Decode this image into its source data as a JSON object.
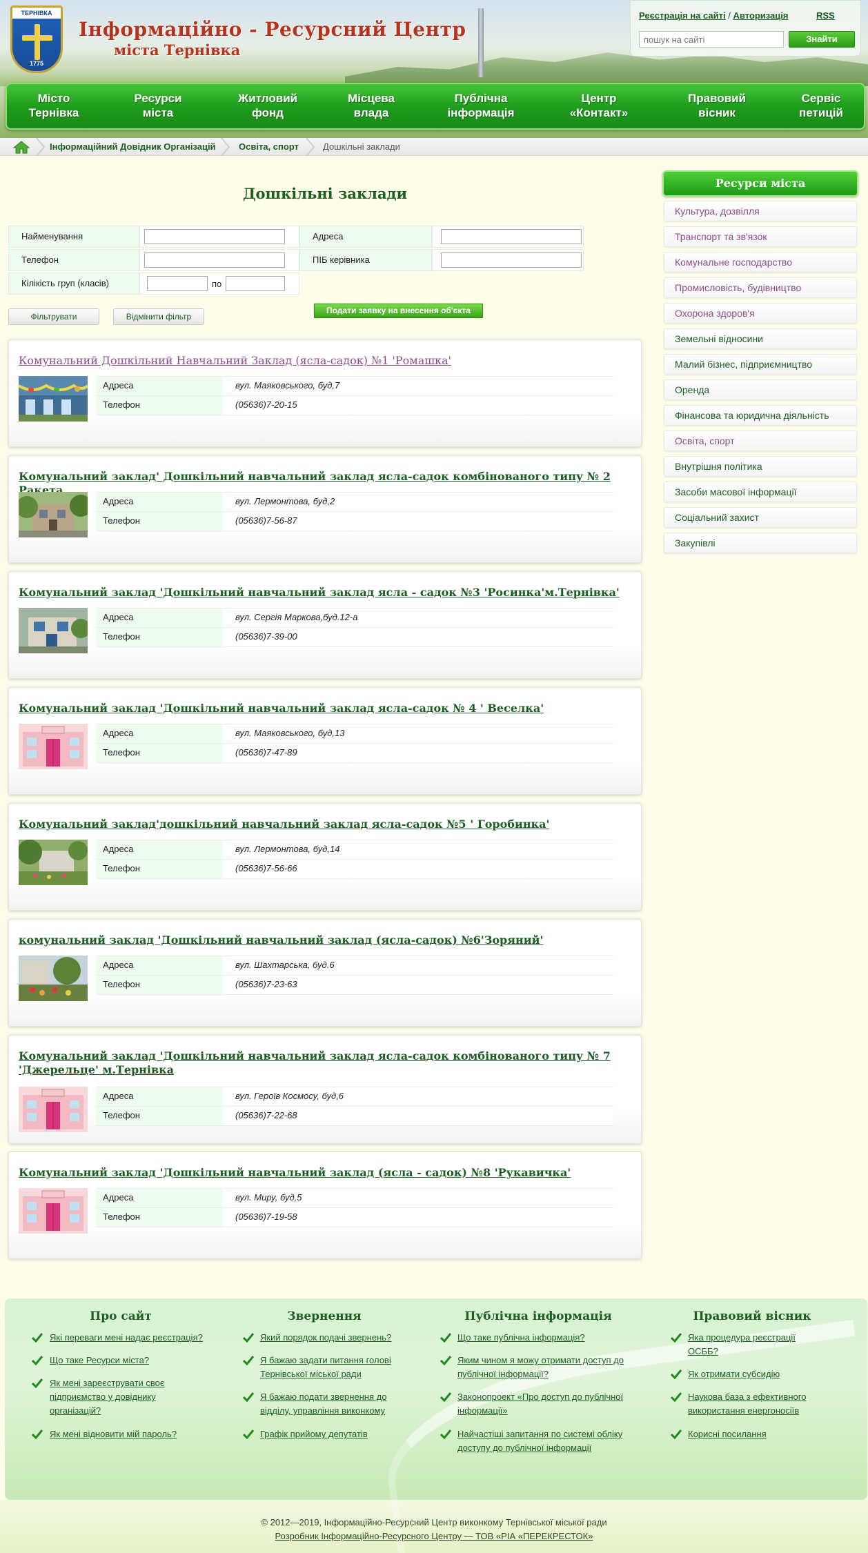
{
  "header": {
    "crest_top": "ТЕРНІВКА",
    "crest_year": "1775",
    "title": "Інформаційно - Ресурсний  Центр",
    "subtitle": "міста Тернівка",
    "register_link": "Реєстрація на сайті",
    "auth_separator": "/",
    "login_link": "Авторизація",
    "rss_link": "RSS",
    "search_placeholder": "пошук на сайті",
    "search_button": "Знайти"
  },
  "nav": [
    {
      "line1": "Місто",
      "line2": "Тернівка"
    },
    {
      "line1": "Ресурси",
      "line2": "міста"
    },
    {
      "line1": "Житловий",
      "line2": "фонд"
    },
    {
      "line1": "Місцева",
      "line2": "влада"
    },
    {
      "line1": "Публічна",
      "line2": "інформація"
    },
    {
      "line1": "Центр",
      "line2": "«Контакт»"
    },
    {
      "line1": "Правовий",
      "line2": "вісник"
    },
    {
      "line1": "Сервіс",
      "line2": "петицій"
    }
  ],
  "breadcrumb": {
    "item1": "Інформаційний Довідник Організацій",
    "item2": "Освіта, спорт",
    "current": "Дошкільні заклади"
  },
  "page_title": "Дошкільні заклади",
  "filter": {
    "name_label": "Найменування",
    "address_label": "Адреса",
    "phone_label": "Телефон",
    "head_label": "ПІБ керівника",
    "groups_label": "Кілікість груп (класів)",
    "to_label": "по",
    "filter_button": "Фільтрувати",
    "reset_button": "Відмінити фільтр",
    "submit_button": "Подати заявку на внесення об'єкта"
  },
  "labels": {
    "address": "Адреса",
    "phone": "Телефон"
  },
  "establishments": [
    {
      "title": "Комунальний Дошкільний Навчальний Заклад (ясла-садок) №1 'Ромашка'",
      "address": "вул. Маяковського, буд,7",
      "phone": "(05636)7-20-15",
      "photo": "photo-kindergarten-garland"
    },
    {
      "title": "Комунальний заклад' Дошкільний навчальний заклад ясла-садок комбінованого типу № 2 Ракета",
      "address": "вул. Лермонтова, буд,2",
      "phone": "(05636)7-56-87",
      "photo": "photo-building-trees"
    },
    {
      "title": "Комунальний заклад 'Дошкільний навчальний заклад ясла - садок №3 'Росинка'м.Тернівка'",
      "address": "вул. Сергія Маркова,буд.12-а",
      "phone": "(05636)7-39-00",
      "photo": "photo-building-entrance"
    },
    {
      "title": "Комунальний заклад 'Дошкільний навчальний заклад ясла-садок № 4 ' Веселка'",
      "address": "вул. Маяковського, буд,13",
      "phone": "(05636)7-47-89",
      "photo": "placeholder-kindergarten"
    },
    {
      "title": "Комунальний заклад'дошкільний навчальний заклад ясла-садок №5 ' Горобинка'",
      "address": "вул. Лермонтова, буд,14",
      "phone": "(05636)7-56-66",
      "photo": "photo-garden"
    },
    {
      "title": "комунальний заклад 'Дошкільний навчальний заклад (ясла-садок) №6'Зоряний'",
      "address": "вул. Шахтарська, буд.6",
      "phone": "(05636)7-23-63",
      "photo": "photo-flowerbed"
    },
    {
      "title": "Комунальний заклад 'Дошкільний навчальний заклад ясла-садок комбінованого типу № 7 'Джерельце' м.Тернівка",
      "address": "вул. Героїв Космосу, буд,6",
      "phone": "(05636)7-22-68",
      "photo": "placeholder-kindergarten"
    },
    {
      "title": "Комунальний заклад 'Дошкільний навчальний заклад (ясла - садок) №8 'Рукавичка'",
      "address": "вул. Миру, буд,5",
      "phone": "(05636)7-19-58",
      "photo": "placeholder-kindergarten"
    }
  ],
  "sidebar": {
    "heading": "Ресурси міста",
    "items": [
      "Культура, дозвілля",
      "Транспорт та зв'язок",
      "Комунальне господарство",
      "Промисловість, будівництво",
      "Охорона здоров'я",
      "Земельні відносини",
      "Малий бізнес, підприємництво",
      "Оренда",
      "Фінансова та юридична діяльність",
      "Освіта, спорт",
      "Внутрішня політика",
      "Засоби масової інформації",
      "Соціальний захист",
      "Закупівлі"
    ]
  },
  "footer": {
    "columns": [
      {
        "heading": "Про сайт",
        "links": [
          [
            "Які переваги мені надає реєстрація?"
          ],
          [
            "Що таке Ресурси міста?"
          ],
          [
            "Як мені зареєструвати своє",
            "підприємство у довіднику",
            "організацій?"
          ],
          [
            "Як мені відновити мій пароль?"
          ]
        ]
      },
      {
        "heading": "Звернення",
        "links": [
          [
            "Який порядок подачі звернень?"
          ],
          [
            "Я бажаю задати питання голові",
            "Тернівської міської ради"
          ],
          [
            "Я бажаю подати звернення до",
            "відділу, управління виконкому"
          ],
          [
            "Графік прийому депутатів"
          ]
        ]
      },
      {
        "heading": "Публічна інформація",
        "links": [
          [
            "Що таке публічна інформація?"
          ],
          [
            "Яким чином я можу отримати доступ до",
            "публічної інформації?"
          ],
          [
            "Законопроект «Про доступ до публічної",
            "інформації»"
          ],
          [
            "Найчастіші запитання по системі обліку",
            "доступу до публічної інформації"
          ]
        ]
      },
      {
        "heading": "Правовий вісник",
        "links": [
          [
            "Яка процедура реєстрації",
            "ОСББ?"
          ],
          [
            "Як отримати субсидію"
          ],
          [
            "Наукова база з ефективного",
            "використання енергоносіїв"
          ],
          [
            "Корисні посилання"
          ]
        ]
      }
    ],
    "copyright": "© 2012—2019, Інформаційно-Ресурсний Центр виконкому Тернівської міської ради",
    "developer": "Розробник Інформаційно-Ресурсного Центру — ТОВ «РІА «ПЕРЕКРЕСТОК»"
  },
  "colors": {
    "accent_green": "#1b5e20",
    "nav_green": "#1f9e1c",
    "title_red": "#b7331e",
    "visited_purple": "#8e4a8d"
  }
}
